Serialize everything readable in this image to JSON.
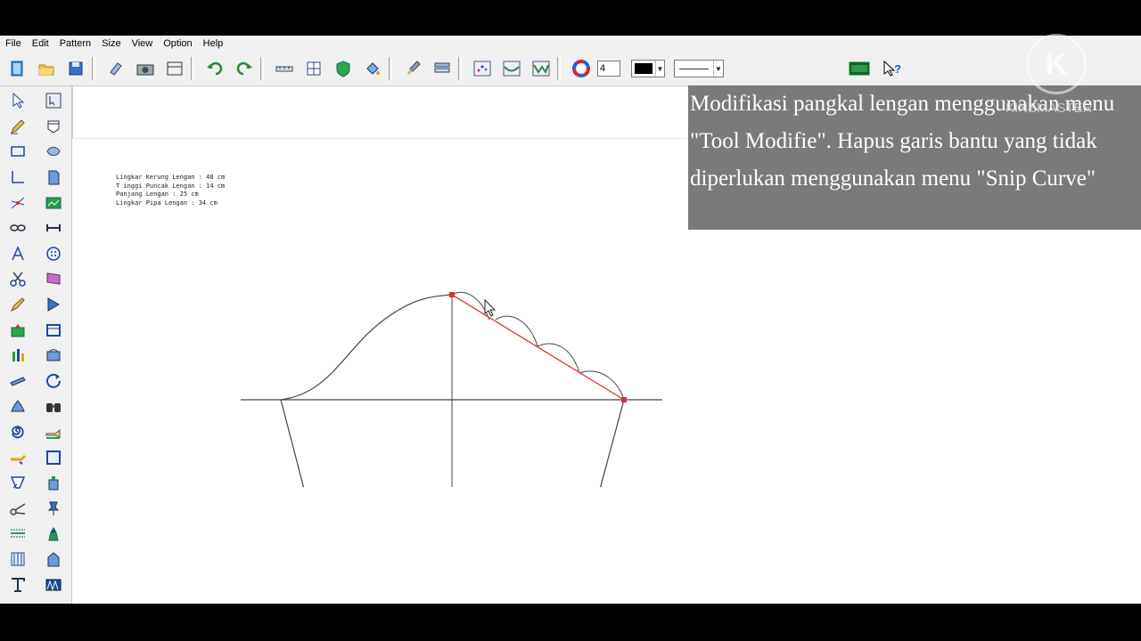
{
  "menu": [
    "File",
    "Edit",
    "Pattern",
    "Size",
    "View",
    "Option",
    "Help"
  ],
  "toolbar": {
    "line_width_value": "4",
    "fill_color": "#000000"
  },
  "pattern_info": [
    "Lingkar Kerung Lengan : 48 cm",
    "T inggi Puncak Lengan : 14 cm",
    "Panjang Lengan : 25 cm",
    "Lingkar Pipa Lengan : 34 cm"
  ],
  "overlay": {
    "text": "Modifikasi pangkal lengan menggunakan menu \"Tool Modifie\". Hapus garis bantu yang tidak diperlukan menggunakan menu \"Snip Curve\""
  },
  "watermark": {
    "text": "KINEMASTER",
    "logo_letter": "K"
  },
  "colors": {
    "accent_red": "#e03030",
    "overlay_bg": "#7a7a7a",
    "window_bg": "#f0f0f0"
  }
}
